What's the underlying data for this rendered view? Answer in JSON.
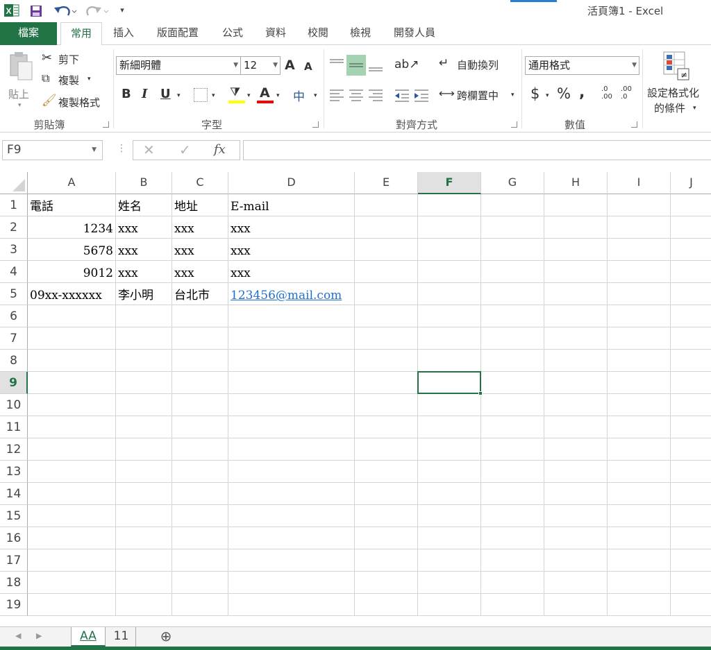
{
  "titlebar": {
    "title": "活頁簿1 - Excel",
    "qat_overflow": "▾"
  },
  "tabs": [
    "檔案",
    "常用",
    "插入",
    "版面配置",
    "公式",
    "資料",
    "校閱",
    "檢視",
    "開發人員"
  ],
  "ribbon": {
    "clipboard": {
      "paste": "貼上",
      "cut": "剪下",
      "copy": "複製",
      "format_painter": "複製格式",
      "label": "剪貼簿"
    },
    "font": {
      "family": "新細明體",
      "size": "12",
      "grow": "A",
      "shrink": "A",
      "bold": "B",
      "italic": "I",
      "underline": "U",
      "phonetic": "中",
      "label": "字型"
    },
    "alignment": {
      "wrap_text": "自動換列",
      "merge_center": "跨欄置中",
      "label": "對齊方式"
    },
    "number": {
      "format": "通用格式",
      "currency": "$",
      "percent": "%",
      "comma": ",",
      "inc_decimal": ".0 .00",
      "dec_decimal": ".00 .0",
      "label": "數值"
    },
    "styles": {
      "conditional_line1": "設定格式化",
      "conditional_line2": "的條件"
    }
  },
  "formula_bar": {
    "name_box": "F9",
    "fx": "fx",
    "content": ""
  },
  "grid": {
    "columns": [
      "A",
      "B",
      "C",
      "D",
      "E",
      "F",
      "G",
      "H",
      "I",
      "J"
    ],
    "rows": [
      "1",
      "2",
      "3",
      "4",
      "5",
      "6",
      "7",
      "8",
      "9",
      "10",
      "11",
      "12",
      "13",
      "14",
      "15",
      "16",
      "17",
      "18",
      "19"
    ],
    "selected_cell": "F9",
    "cells": [
      [
        "電話",
        "姓名",
        "地址",
        "E-mail"
      ],
      [
        "1234",
        "xxx",
        "xxx",
        "xxx"
      ],
      [
        "5678",
        "xxx",
        "xxx",
        "xxx"
      ],
      [
        "9012",
        "xxx",
        "xxx",
        "xxx"
      ],
      [
        "09xx-xxxxxx",
        "李小明",
        "台北市",
        "123456@mail.com"
      ]
    ]
  },
  "sheets": {
    "tabs": [
      "AA",
      "11"
    ],
    "active": "AA",
    "add": "⊕"
  },
  "colors": {
    "excel_green": "#217346",
    "link": "#1f6fd1",
    "accent_blue": "#2b7cd3"
  }
}
